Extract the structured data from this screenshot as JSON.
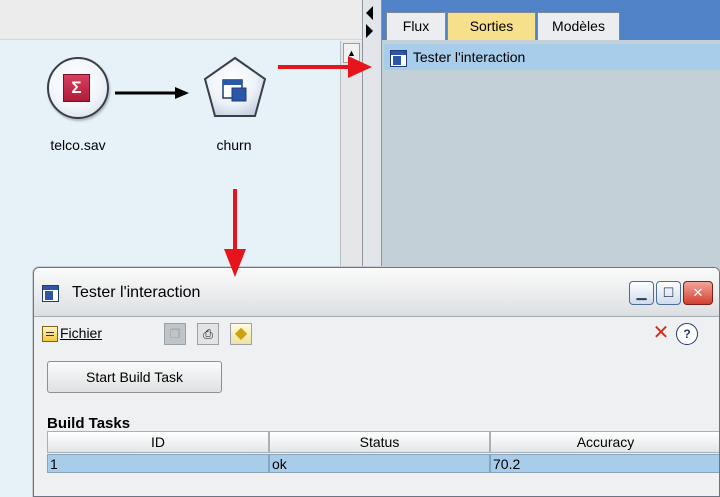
{
  "stream_canvas": {
    "nodes": [
      {
        "label": "telco.sav",
        "icon": "sigma-source-icon"
      },
      {
        "label": "churn",
        "icon": "model-nugget-icon"
      }
    ]
  },
  "manager": {
    "tabs": [
      {
        "label": "Flux",
        "active": false
      },
      {
        "label": "Sorties",
        "active": true
      },
      {
        "label": "Modèles",
        "active": false
      }
    ],
    "outputs": [
      {
        "label": "Tester l'interaction",
        "icon": "output-window-icon",
        "selected": true
      }
    ]
  },
  "dialog": {
    "title": "Tester l'interaction",
    "menu_file": "Fichier",
    "start_button": "Start Build Task",
    "section_title": "Build Tasks",
    "table": {
      "columns": [
        "ID",
        "Status",
        "Accuracy"
      ],
      "rows": [
        {
          "id": "1",
          "status": "ok",
          "accuracy": "70.2"
        }
      ]
    }
  },
  "colors": {
    "canvas_bg": "#e6f1f8",
    "tab_bar": "#4f82c7",
    "active_tab": "#f7e08b",
    "selection": "#a8cdea",
    "annotation_arrow": "#e8141b"
  }
}
